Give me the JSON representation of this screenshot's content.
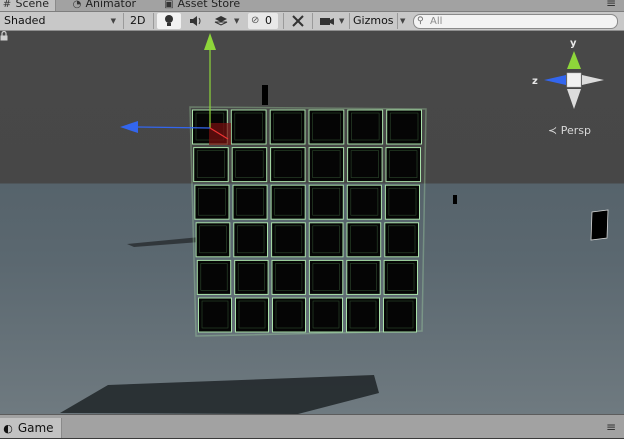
{
  "tabs": {
    "scene": {
      "label": "Scene",
      "icon": "scene-grid-icon"
    },
    "animator": {
      "label": "Animator",
      "icon": "animator-icon"
    },
    "asset_store": {
      "label": "Asset Store",
      "icon": "asset-store-icon"
    }
  },
  "toolbar": {
    "shading_mode": "Shaded",
    "mode_2d": "2D",
    "hidden_count": "0",
    "gizmos_label": "Gizmos",
    "search_placeholder": "All"
  },
  "scene_gizmo": {
    "axis_y": "y",
    "axis_z": "z",
    "projection": "Persp"
  },
  "bottom": {
    "game_tab": "Game"
  },
  "colors": {
    "x_axis": "#ee3333",
    "y_axis": "#8ed63a",
    "z_axis": "#3366ee",
    "selection_outline": "#a8e0a8"
  }
}
